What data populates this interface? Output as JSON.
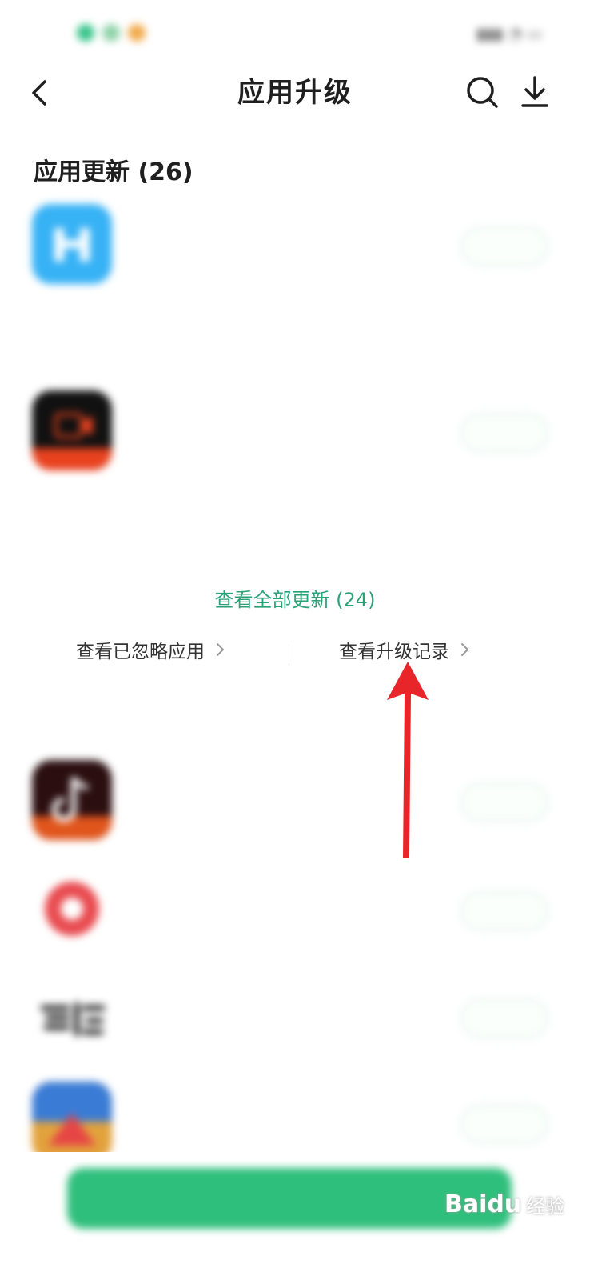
{
  "header": {
    "title": "应用升级"
  },
  "updates_section": {
    "title": "应用更新 (26)"
  },
  "update_apps": [
    {
      "name": "",
      "sub1": "",
      "sub2": "",
      "desc1": "",
      "desc2": "",
      "action": "",
      "icon_color": "#37b2f5"
    },
    {
      "name": "",
      "sub1": "",
      "sub2": "",
      "desc1": "",
      "desc2": "",
      "action": "",
      "icon_color": "#111111"
    }
  ],
  "links": {
    "view_all": "查看全部更新 (24)",
    "ignored": "查看已忽略应用",
    "history": "查看升级记录"
  },
  "recommend_section": {
    "title": ""
  },
  "recommend_apps": [
    {
      "name": "",
      "sub": "",
      "desc": "",
      "action": "",
      "icon_color": "#2a0e10"
    },
    {
      "name": "",
      "sub": "",
      "desc": "",
      "action": "",
      "icon_color": "#e84b50"
    },
    {
      "name": "",
      "sub": "",
      "desc": "",
      "action": "",
      "icon_color": "#ffffff"
    },
    {
      "name": "",
      "sub": "",
      "desc": "",
      "action": "",
      "icon_color": "#e2a23c"
    }
  ],
  "bottom_button": {
    "label": ""
  },
  "watermark": {
    "brand": "Baidu",
    "sub": "经验"
  },
  "colors": {
    "accent_green": "#2aa277",
    "annotation_red": "#e8262a"
  },
  "icons": [
    "back-icon",
    "search-icon",
    "download-icon",
    "chevron-right-icon",
    "red-arrow-annotation"
  ]
}
